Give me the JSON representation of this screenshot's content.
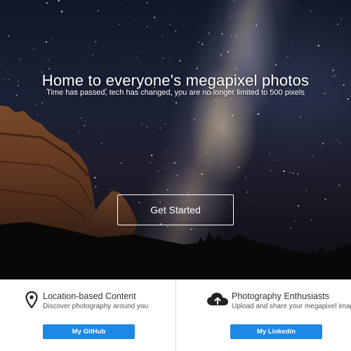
{
  "hero": {
    "title": "Home to everyone's megapixel photos",
    "subtitle": "Time has passed, tech has changed, you are no longer limited to 500 pixels",
    "cta_label": "Get Started"
  },
  "features": [
    {
      "icon": "map-pin-icon",
      "title": "Location-based Content",
      "description": "Discover photography around you",
      "button_label": "My GitHub"
    },
    {
      "icon": "cloud-upload-icon",
      "title": "Photography Enthusiasts",
      "description": "Upload and share your megapixel images",
      "button_label": "My Linkedin"
    }
  ],
  "colors": {
    "accent": "#1e88e5",
    "hero_text": "#ffffff",
    "feature_title": "#333333"
  }
}
